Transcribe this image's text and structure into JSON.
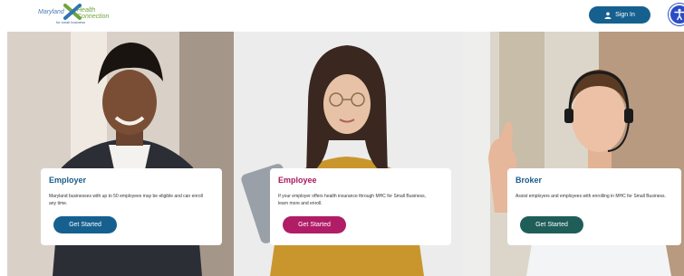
{
  "header": {
    "logo": {
      "line1": "Maryland",
      "line2": "Health Connection",
      "sub": "for small business"
    },
    "signin_label": "Sign In"
  },
  "cards": [
    {
      "title": "Employer",
      "text": "Maryland businesses with up to 50 employees may be eligible and can enroll any time.",
      "button": "Get Started"
    },
    {
      "title": "Employee",
      "text": "If your employer offers health insurance through MHC for Small Business, learn more and enroll.",
      "button": "Get Started"
    },
    {
      "title": "Broker",
      "text": "Assist employers and employees with enrolling in MHC for Small Business.",
      "button": "Get Started"
    }
  ],
  "colors": {
    "primary": "#16608f",
    "employee_accent": "#b01d66",
    "broker_accent": "#1f5e58",
    "a11y_blue": "#2b4cc4"
  }
}
